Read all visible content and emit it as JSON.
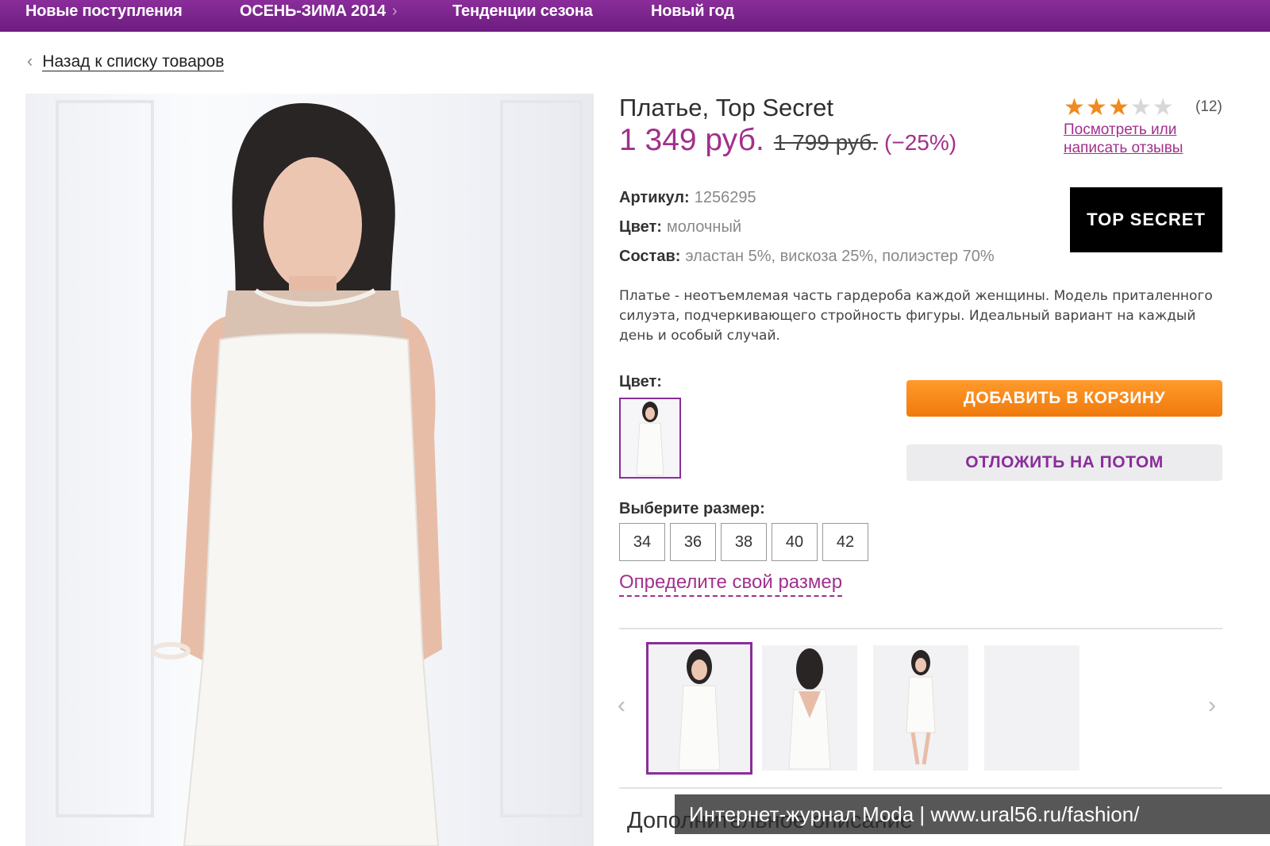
{
  "nav": {
    "items": [
      "Новые поступления",
      "ОСЕНЬ-ЗИМА 2014",
      "Тенденции сезона",
      "Новый год"
    ]
  },
  "back_link": "Назад к списку товаров",
  "product": {
    "title": "Платье, Top Secret",
    "price": "1 349 руб.",
    "old_price": "1 799 руб.",
    "discount": "(−25%)",
    "rating_value": 3,
    "rating_max": 5,
    "rating_count": "(12)",
    "reviews_link": "Посмотреть или написать отзывы",
    "brand_logo_text": "TOP SECRET",
    "attributes": [
      {
        "label": "Артикул:",
        "value": "1256295"
      },
      {
        "label": "Цвет:",
        "value": "молочный"
      },
      {
        "label": "Состав:",
        "value": "эластан 5%, вискоза 25%, полиэстер 70%"
      }
    ],
    "description": "Платье - неотъемлемая часть гардероба каждой женщины. Модель приталенного силуэта, подчеркивающего стройность фигуры. Идеальный вариант на каждый день и особый случай.",
    "color_label": "Цвет:",
    "size_label": "Выберите размер:",
    "sizes": [
      "34",
      "36",
      "38",
      "40",
      "42"
    ],
    "size_help_link": "Определите свой размер",
    "add_to_cart": "ДОБАВИТЬ В КОРЗИНУ",
    "save_for_later": "ОТЛОЖИТЬ НА ПОТОМ",
    "extra_section": "Дополнительное описание"
  },
  "watermark": "Интернет-журнал Moda | www.ural56.ru/fashion/",
  "colors": {
    "nav_bg": "#7a2289",
    "accent": "#a1308c",
    "cart_button": "#f5820f",
    "later_button_bg": "#ececee"
  },
  "icons": [
    "chevron-left-icon",
    "chevron-right-icon",
    "star-icon"
  ]
}
